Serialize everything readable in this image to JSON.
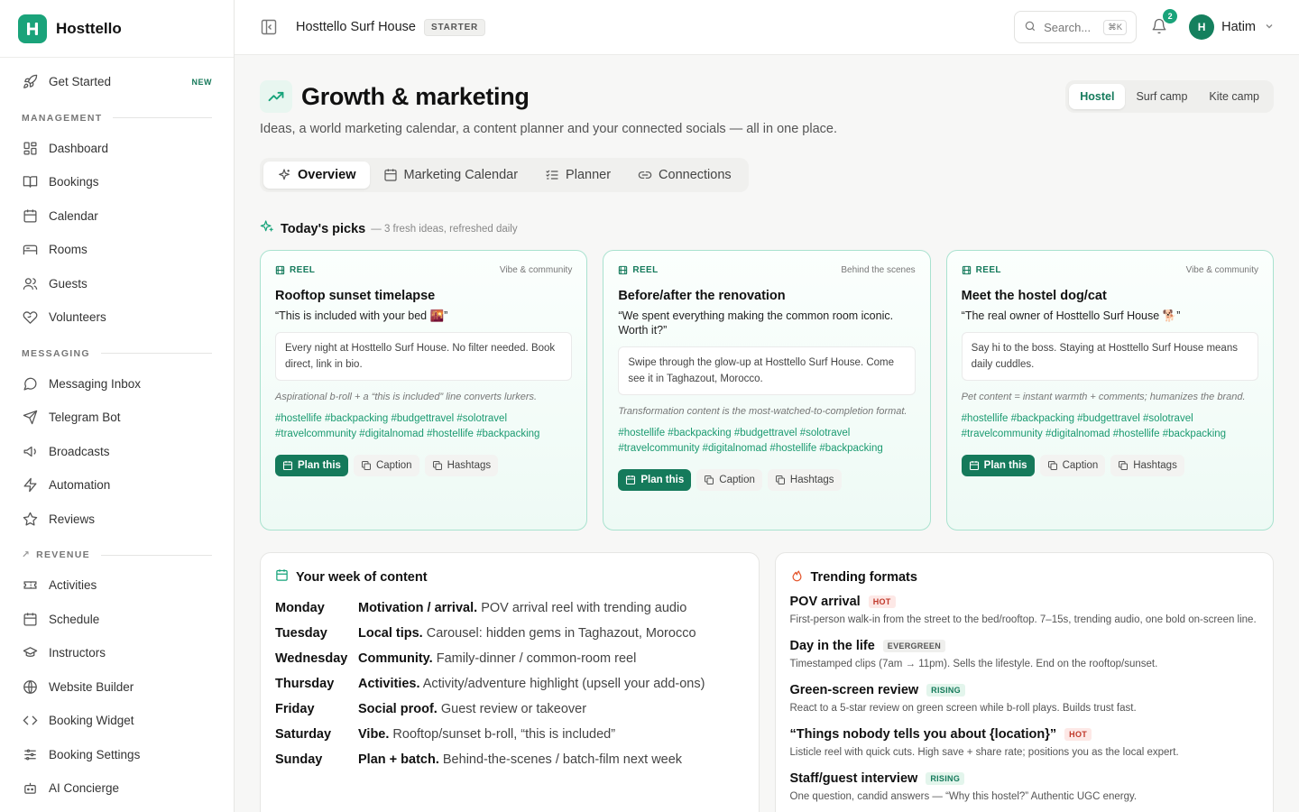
{
  "brand": {
    "name": "Hosttello"
  },
  "sidebar": {
    "get_started": {
      "label": "Get Started",
      "badge": "NEW"
    },
    "sections": [
      {
        "title": "MANAGEMENT",
        "items": [
          "Dashboard",
          "Bookings",
          "Calendar",
          "Rooms",
          "Guests",
          "Volunteers"
        ]
      },
      {
        "title": "MESSAGING",
        "items": [
          "Messaging Inbox",
          "Telegram Bot",
          "Broadcasts",
          "Automation",
          "Reviews"
        ]
      },
      {
        "title": "REVENUE",
        "items": [
          "Activities",
          "Schedule",
          "Instructors",
          "Website Builder",
          "Booking Widget",
          "Booking Settings",
          "AI Concierge"
        ]
      }
    ]
  },
  "topbar": {
    "property": "Hosttello Surf House",
    "plan": "STARTER",
    "search_placeholder": "Search...",
    "search_kbd": "⌘K",
    "notifications": "2",
    "user_initial": "H",
    "user_name": "Hatim"
  },
  "page": {
    "title": "Growth & marketing",
    "subtitle": "Ideas, a world marketing calendar, a content planner and your connected socials — all in one place.",
    "segments": [
      "Hostel",
      "Surf camp",
      "Kite camp"
    ],
    "tabs": [
      "Overview",
      "Marketing Calendar",
      "Planner",
      "Connections"
    ]
  },
  "picks": {
    "title": "Today's picks",
    "subtitle": "— 3 fresh ideas, refreshed daily",
    "cards": [
      {
        "type": "REEL",
        "category": "Vibe & community",
        "title": "Rooftop sunset timelapse",
        "quote": "“This is included with your bed 🌇”",
        "caption": "Every night at Hosttello Surf House. No filter needed. Book direct, link in bio.",
        "note": "Aspirational b-roll + a “this is included” line converts lurkers.",
        "tags": "#hostellife #backpacking #budgettravel #solotravel #travelcommunity #digitalnomad #hostellife #backpacking",
        "plan": "Plan this",
        "caption_btn": "Caption",
        "hashtags_btn": "Hashtags"
      },
      {
        "type": "REEL",
        "category": "Behind the scenes",
        "title": "Before/after the renovation",
        "quote": "“We spent everything making the common room iconic. Worth it?”",
        "caption": "Swipe through the glow-up at Hosttello Surf House. Come see it in Taghazout, Morocco.",
        "note": "Transformation content is the most-watched-to-completion format.",
        "tags": "#hostellife #backpacking #budgettravel #solotravel #travelcommunity #digitalnomad #hostellife #backpacking",
        "plan": "Plan this",
        "caption_btn": "Caption",
        "hashtags_btn": "Hashtags"
      },
      {
        "type": "REEL",
        "category": "Vibe & community",
        "title": "Meet the hostel dog/cat",
        "quote": "“The real owner of Hosttello Surf House 🐕”",
        "caption": "Say hi to the boss. Staying at Hosttello Surf House means daily cuddles.",
        "note": "Pet content = instant warmth + comments; humanizes the brand.",
        "tags": "#hostellife #backpacking #budgettravel #solotravel #travelcommunity #digitalnomad #hostellife #backpacking",
        "plan": "Plan this",
        "caption_btn": "Caption",
        "hashtags_btn": "Hashtags"
      }
    ]
  },
  "week": {
    "title": "Your week of content",
    "days": [
      {
        "day": "Monday",
        "head": "Motivation / arrival.",
        "text": "POV arrival reel with trending audio"
      },
      {
        "day": "Tuesday",
        "head": "Local tips.",
        "text": "Carousel: hidden gems in Taghazout, Morocco"
      },
      {
        "day": "Wednesday",
        "head": "Community.",
        "text": "Family-dinner / common-room reel"
      },
      {
        "day": "Thursday",
        "head": "Activities.",
        "text": "Activity/adventure highlight (upsell your add-ons)"
      },
      {
        "day": "Friday",
        "head": "Social proof.",
        "text": "Guest review or takeover"
      },
      {
        "day": "Saturday",
        "head": "Vibe.",
        "text": "Rooftop/sunset b-roll, “this is included”"
      },
      {
        "day": "Sunday",
        "head": "Plan + batch.",
        "text": "Behind-the-scenes / batch-film next week"
      }
    ]
  },
  "trending": {
    "title": "Trending formats",
    "items": [
      {
        "title": "POV arrival",
        "tag": "HOT",
        "kind": "hot",
        "desc": "First-person walk-in from the street to the bed/rooftop. 7–15s, trending audio, one bold on-screen line."
      },
      {
        "title": "Day in the life",
        "tag": "EVERGREEN",
        "kind": "ever",
        "desc": "Timestamped clips (7am → 11pm). Sells the lifestyle. End on the rooftop/sunset."
      },
      {
        "title": "Green-screen review",
        "tag": "RISING",
        "kind": "rise",
        "desc": "React to a 5-star review on green screen while b-roll plays. Builds trust fast."
      },
      {
        "title": "“Things nobody tells you about {location}”",
        "tag": "HOT",
        "kind": "hot",
        "desc": "Listicle reel with quick cuts. High save + share rate; positions you as the local expert."
      },
      {
        "title": "Staff/guest interview",
        "tag": "RISING",
        "kind": "rise",
        "desc": "One question, candid answers — “Why this hostel?” Authentic UGC energy."
      }
    ]
  },
  "colors": {
    "accent": "#1aa37a",
    "accent_dark": "#157a5b"
  }
}
